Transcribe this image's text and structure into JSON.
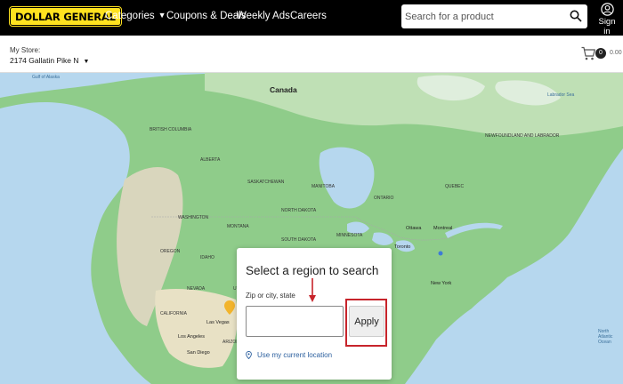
{
  "header": {
    "logo_text": "DOLLAR GENERAL",
    "nav": [
      {
        "label": "Categories",
        "has_dropdown": true
      },
      {
        "label": "Coupons & Deals"
      },
      {
        "label": "Weekly Ads"
      },
      {
        "label": "Careers"
      }
    ],
    "search_placeholder": "Search for a product",
    "signin_label": "Sign in"
  },
  "store": {
    "label": "My Store:",
    "name": "2174 Gallatin Pike N"
  },
  "cart": {
    "count": "0",
    "total": "0.00"
  },
  "map": {
    "labels": {
      "canada": "Canada",
      "gulf_alaska": "Gulf of Alaska",
      "labrador_sea": "Labrador Sea",
      "british_columbia": "BRITISH COLUMBIA",
      "alberta": "ALBERTA",
      "saskatchewan": "SASKATCHEWAN",
      "manitoba": "MANITOBA",
      "ontario": "ONTARIO",
      "quebec": "QUEBEC",
      "newfoundland": "NEWFOUNDLAND AND LABRADOR",
      "washington": "WASHINGTON",
      "montana": "MONTANA",
      "north_dakota": "NORTH DAKOTA",
      "south_dakota": "SOUTH DAKOTA",
      "minnesota": "MINNESOTA",
      "oregon": "OREGON",
      "idaho": "IDAHO",
      "nevada": "NEVADA",
      "utah": "UTAH",
      "california": "CALIFORNIA",
      "arizona": "ARIZONA",
      "las_vegas": "Las Vegas",
      "los_angeles": "Los Angeles",
      "san_diego": "San Diego",
      "ottawa": "Ottawa",
      "montreal": "Montreal",
      "toronto": "Toronto",
      "new_york": "New York",
      "north_atlantic": "North Atlantic Ocean"
    }
  },
  "region_dialog": {
    "title": "Select a region to search",
    "zip_label": "Zip or city, state",
    "zip_value": "",
    "apply_label": "Apply",
    "current_location_label": "Use my current location"
  },
  "colors": {
    "brand_yellow": "#ffe21f",
    "topbar": "#000000",
    "highlight": "#c7242b",
    "link": "#2b5f9e"
  }
}
